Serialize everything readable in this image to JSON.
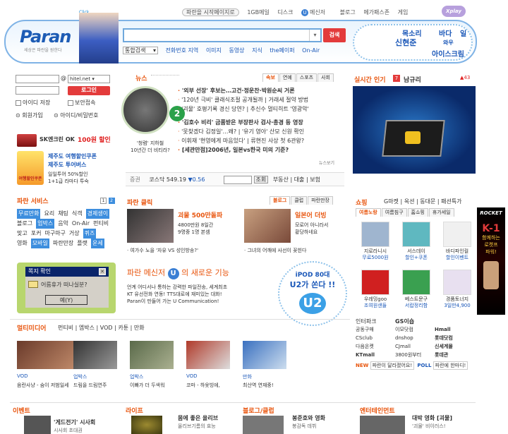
{
  "header": {
    "logo": "Paran",
    "slogan": "세상은 파란을 원한다",
    "click": "Click",
    "top_nav": [
      "파란을 시작페이지로",
      "1GB메일",
      "디스크",
      "메신저",
      "블로그",
      "메가패스존",
      "게임"
    ],
    "xplay": "Xplay",
    "search_button": "검색",
    "search_select": "통합검색",
    "search_tabs": [
      "전화번호 지역",
      "이미지",
      "동영상",
      "지식",
      "the페이퍼",
      "On-Air"
    ],
    "hot_words": [
      "목소리",
      "바다",
      "일",
      "신현준",
      "와우",
      "아이스크림"
    ]
  },
  "login": {
    "domain": "hitel.net",
    "login_btn": "로그인",
    "save_id": "아이디 저장",
    "secure": "보안접속",
    "join": "회원가입",
    "find": "아이디/비밀번호"
  },
  "ads_left": {
    "sk_title": "SK엔크린 OK",
    "sk_promo": "100원 할인",
    "jeju_title": "제주도 여행할인쿠폰",
    "jeju_sub": "제주도 투어버스",
    "jeju_desc1": "일일투어 50%할인",
    "jeju_desc2": "1+1급 라마다 투숙",
    "jeju_badge": "여행할인쿠폰"
  },
  "services": {
    "title": "파란 서비스",
    "pages": [
      "1",
      "2"
    ],
    "rows": [
      [
        {
          "t": "무료만화",
          "hl": true
        },
        {
          "t": "요리"
        },
        {
          "t": "채팅"
        },
        {
          "t": "식객"
        },
        {
          "t": "경제생이",
          "hl": true
        }
      ],
      [
        {
          "t": "블로그"
        },
        {
          "t": "업박스",
          "hl": true
        },
        {
          "t": "음악"
        },
        {
          "t": "On-Air"
        },
        {
          "t": "펀티비"
        }
      ],
      [
        {
          "t": "맞고"
        },
        {
          "t": "포커"
        },
        {
          "t": "마구마구"
        },
        {
          "t": "거상"
        },
        {
          "t": "퀴즈",
          "hl": true
        }
      ],
      [
        {
          "t": "영화"
        },
        {
          "t": "모바일",
          "hl": true
        },
        {
          "t": "파란만장"
        },
        {
          "t": "플랫"
        },
        {
          "t": "운세",
          "hl": true
        }
      ]
    ]
  },
  "popup": {
    "title": "쪽지 확인",
    "message": "어름휴가 떠나실분?",
    "ok": "예(Y)"
  },
  "news": {
    "title": "뉴스",
    "tabs": [
      "속보",
      "연예",
      "스포츠",
      "사회"
    ],
    "photo_caption1": "'청렴' 지하철",
    "photo_caption2": "10년간 더 비티라?",
    "items": [
      {
        "t": "'외부 선장' 후보는…고건·정운찬·박원순씨 거론",
        "bold": true
      },
      {
        "t": "'120년 극비' 클래식조절 공개될까  |  거래세 절약 방법",
        "bold": false
      },
      {
        "t": "'괴물' 호평기록 경신 당연?  |  추신수 멀티히트 '영광악'",
        "bold": false
      },
      {
        "t": "'김호수 비리' 금품받은 부장판사 검사·총경 등 영장",
        "bold": true
      },
      {
        "t": "'못찾겠다 김정일'…왜?  |  '유기 영아' 산모 신원 확인",
        "bold": false
      },
      {
        "t": "이휘재 '현영에게 마음있다'  |  류현진 사상 첫 6관왕?",
        "bold": false
      },
      {
        "t": "[세관만점]2006년, 일본vs한국 미의 기준?",
        "bold": true
      }
    ],
    "more": "뉴스보기",
    "stock_label": "증권",
    "stock_name": "코스닥",
    "stock_value": "549.19",
    "stock_change": "▼0.56",
    "stock_query": "조회",
    "stock_links": [
      "부동산",
      "대출",
      "보험"
    ]
  },
  "paran_click": {
    "title": "파란 클릭",
    "tabs": [
      "블로그",
      "클럽",
      "파란만장"
    ],
    "item1_title": "괴물 500만돌파",
    "item1_desc1": "4800만원 8일간",
    "item1_desc2": "9명중 1명 본셈",
    "item2_title": "일본어 더빙",
    "item2_desc1": "모로어 아니라서",
    "item2_desc2": "황당하네요",
    "cap1": "여가수 노을 '자유 VS 성인방송?'",
    "cap2": "그녀의 어깨에 사선이 꽂힌다"
  },
  "messenger": {
    "title_a": "파란 메신저",
    "title_b": "의 새로운 기능",
    "desc1": "언계 어디서나 통하는 강력한 파일전송, 세계최초",
    "desc2": "KT 유선전화 연동! TTS대로에 재미있는 대화!",
    "desc3": "Paran이 만들어 가는 U Communication!",
    "ipod1": "iPOD 80대",
    "ipod2": "U2가 쏜다 !!"
  },
  "multimedia": {
    "title": "멀티미디어",
    "tabs": [
      "펀티비",
      "엠박스",
      "VOD",
      "카툰",
      "만화"
    ],
    "items": [
      {
        "tag": "VOD",
        "cap": "음란사냥 - 숨이 저범일세"
      },
      {
        "tag": "업박스",
        "cap": "드림을 드림연주"
      },
      {
        "tag": "업박스",
        "cap": "이빠가 더 두색워"
      },
      {
        "tag": "VOD",
        "cap": "코마 - 하윳빙에,"
      },
      {
        "tag": "만화",
        "cap": "최산역 연재중!"
      }
    ]
  },
  "live_search": {
    "title": "실시간 인기",
    "rank": "7",
    "keyword": "남규리",
    "change": "43"
  },
  "shopping": {
    "title": "쇼핑",
    "top": [
      "G마켓",
      "옥션",
      "동대문",
      "패션특가"
    ],
    "tabs": [
      "여름노랑",
      "여름침구",
      "홈쇼핑",
      "휴가세일"
    ],
    "items": [
      {
        "cap1": "지로라니시",
        "cap2": "무료5000원"
      },
      {
        "cap1": "서스데이",
        "cap2": "할인+쿠폰"
      },
      {
        "cap1": "바디파인컬",
        "cap2": "할인이벤트"
      },
      {
        "cap1": "우레밍goo",
        "cap2": "조여원샌들"
      },
      {
        "cap1": "베스트문구",
        "cap2": "서랍정리함"
      },
      {
        "cap1": "경품토너지",
        "cap2": "3일만4,900"
      }
    ],
    "inter_title": "인터파크",
    "gs_title": "GS이숍",
    "partners": [
      [
        "공동구매",
        "이모닷컴",
        "Hmall"
      ],
      [
        "CSclub",
        "dnshop",
        "롯데닷컴"
      ],
      [
        "다음온켓",
        "CJmall",
        "신세계몰"
      ],
      [
        "KTmall",
        "3800원부터",
        "롯데관"
      ]
    ],
    "new_label": "NEW",
    "new_text": "파란이 달라졌어요!",
    "poll_label": "POLL",
    "poll_text": "파란에 한마디!"
  },
  "banner": {
    "brand": "ROCKET",
    "text1": "K-1",
    "text2": "함께하는",
    "text3": "로켓프",
    "text4": "파워!"
  },
  "bottom": {
    "event": "이벤트",
    "event_item": "'게드전기' 시사회",
    "event_sub": "시사회 초대권",
    "life": "라이프",
    "life_item": "몸에 좋은 올리브",
    "life_sub": "올리브기름의 효능",
    "blog": "블로그/클럽",
    "blog_item": "봉준호와 영화",
    "blog_sub": "봉감독 데뷔",
    "ent": "엔터테인먼트",
    "ent_item": "대박 영화 [괴물]",
    "ent_sub": "'괴물' 비이러스!"
  }
}
